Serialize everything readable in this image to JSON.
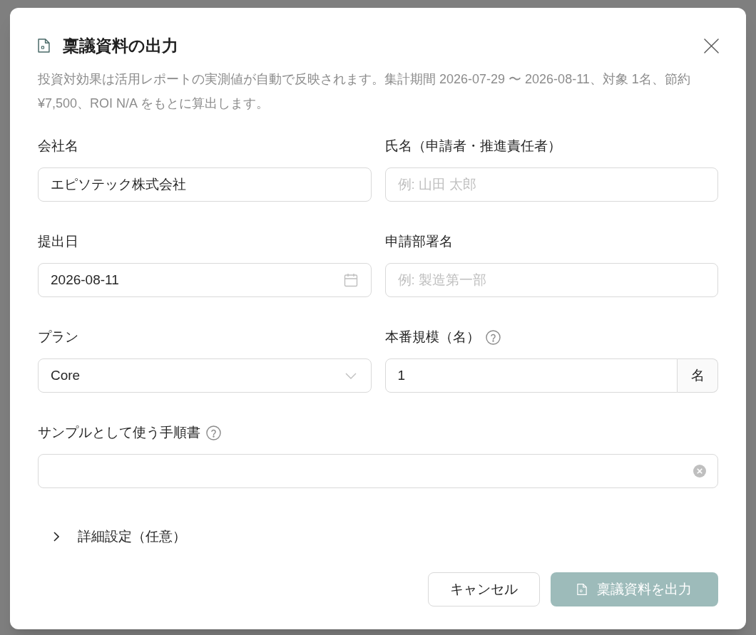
{
  "dialog": {
    "title": "稟議資料の出力",
    "description": "投資対効果は活用レポートの実測値が自動で反映されます。集計期間 2026-07-29 〜 2026-08-11、対象 1名、節約 ¥7,500、ROI N/A をもとに算出します。"
  },
  "rows": [
    [
      {
        "kind": "text",
        "label": "会社名",
        "value": "エピソテック株式会社"
      },
      {
        "kind": "text",
        "label": "氏名（申請者・推進責任者）",
        "placeholder": "例: 山田 太郎"
      }
    ],
    [
      {
        "kind": "date",
        "label": "提出日",
        "value": "2026-08-11"
      },
      {
        "kind": "text",
        "label": "申請部署名",
        "placeholder": "例: 製造第一部"
      }
    ],
    [
      {
        "kind": "select",
        "label": "プラン",
        "value": "Core"
      },
      {
        "kind": "number",
        "label": "本番規模（名）",
        "help": true,
        "value": "1",
        "suffix": "名"
      }
    ],
    [
      {
        "kind": "combobox",
        "label": "サンプルとして使う手順書",
        "help": true
      }
    ]
  ],
  "advanced": {
    "label": "詳細設定（任意）",
    "expanded": false
  },
  "buttons": [
    {
      "kind": "secondary",
      "label": "キャンセル",
      "disabled": false
    },
    {
      "kind": "primary",
      "label": "稟議資料を出力",
      "disabled": true
    }
  ]
}
